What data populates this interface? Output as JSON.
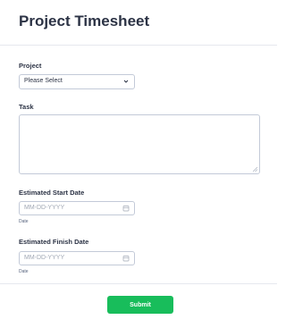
{
  "form": {
    "title": "Project Timesheet"
  },
  "fields": {
    "project": {
      "label": "Project",
      "value": "Please Select"
    },
    "task": {
      "label": "Task",
      "value": ""
    },
    "start_date": {
      "label": "Estimated Start Date",
      "placeholder": "MM-DD-YYYY",
      "sublabel": "Date"
    },
    "finish_date": {
      "label": "Estimated Finish Date",
      "placeholder": "MM-DD-YYYY",
      "sublabel": "Date"
    }
  },
  "submit": {
    "label": "Submit"
  },
  "icons": {
    "select": "chevron-down-icon",
    "textarea": "resize-handle-icon",
    "date": "calendar-icon"
  },
  "colors": {
    "text": "#2c3345",
    "border": "#c3cad8",
    "placeholder": "#a0a7b4",
    "submit": "#18bd5b"
  }
}
